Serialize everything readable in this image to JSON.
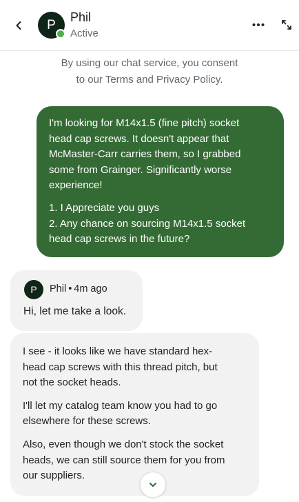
{
  "header": {
    "agent_name": "Phil",
    "agent_initial": "P",
    "status": "Active",
    "status_color": "#4fb048"
  },
  "icons": {
    "back": "chevron-left-icon",
    "more": "more-horizontal-icon",
    "expand": "expand-icon",
    "scroll_down": "chevron-down-icon"
  },
  "consent": {
    "prefix": "By using our chat service, you consent",
    "line2_prefix": "to our ",
    "terms_link": "Terms and Privacy Policy",
    "line2_suffix": "."
  },
  "user_message": {
    "bubble_color": "#346b35",
    "paragraph1_lines": [
      "I'm looking for M14x1.5 (fine pitch) socket",
      "head cap screws. It doesn't appear that",
      "McMaster-Carr carries them, so I grabbed",
      "some from Grainger. Significantly worse",
      "experience!"
    ],
    "paragraph2_lines": [
      "1. I Appreciate you guys",
      "2. Any chance on sourcing M14x1.5 socket",
      "head cap screws in the future?"
    ]
  },
  "agent_message_1": {
    "author": "Phil",
    "separator": "•",
    "time": "4m ago",
    "text": "Hi, let me take a look."
  },
  "agent_message_2": {
    "paragraph1_lines": [
      "I see - it looks like we have standard hex-",
      "head cap screws with this thread pitch, but",
      "not the socket heads."
    ],
    "paragraph2_lines": [
      "I'll let my catalog team know you had to go",
      "elsewhere for these screws."
    ],
    "paragraph3_lines": [
      "Also, even though we don't stock the socket",
      "heads, we can still source them for you from",
      "our suppliers."
    ]
  }
}
